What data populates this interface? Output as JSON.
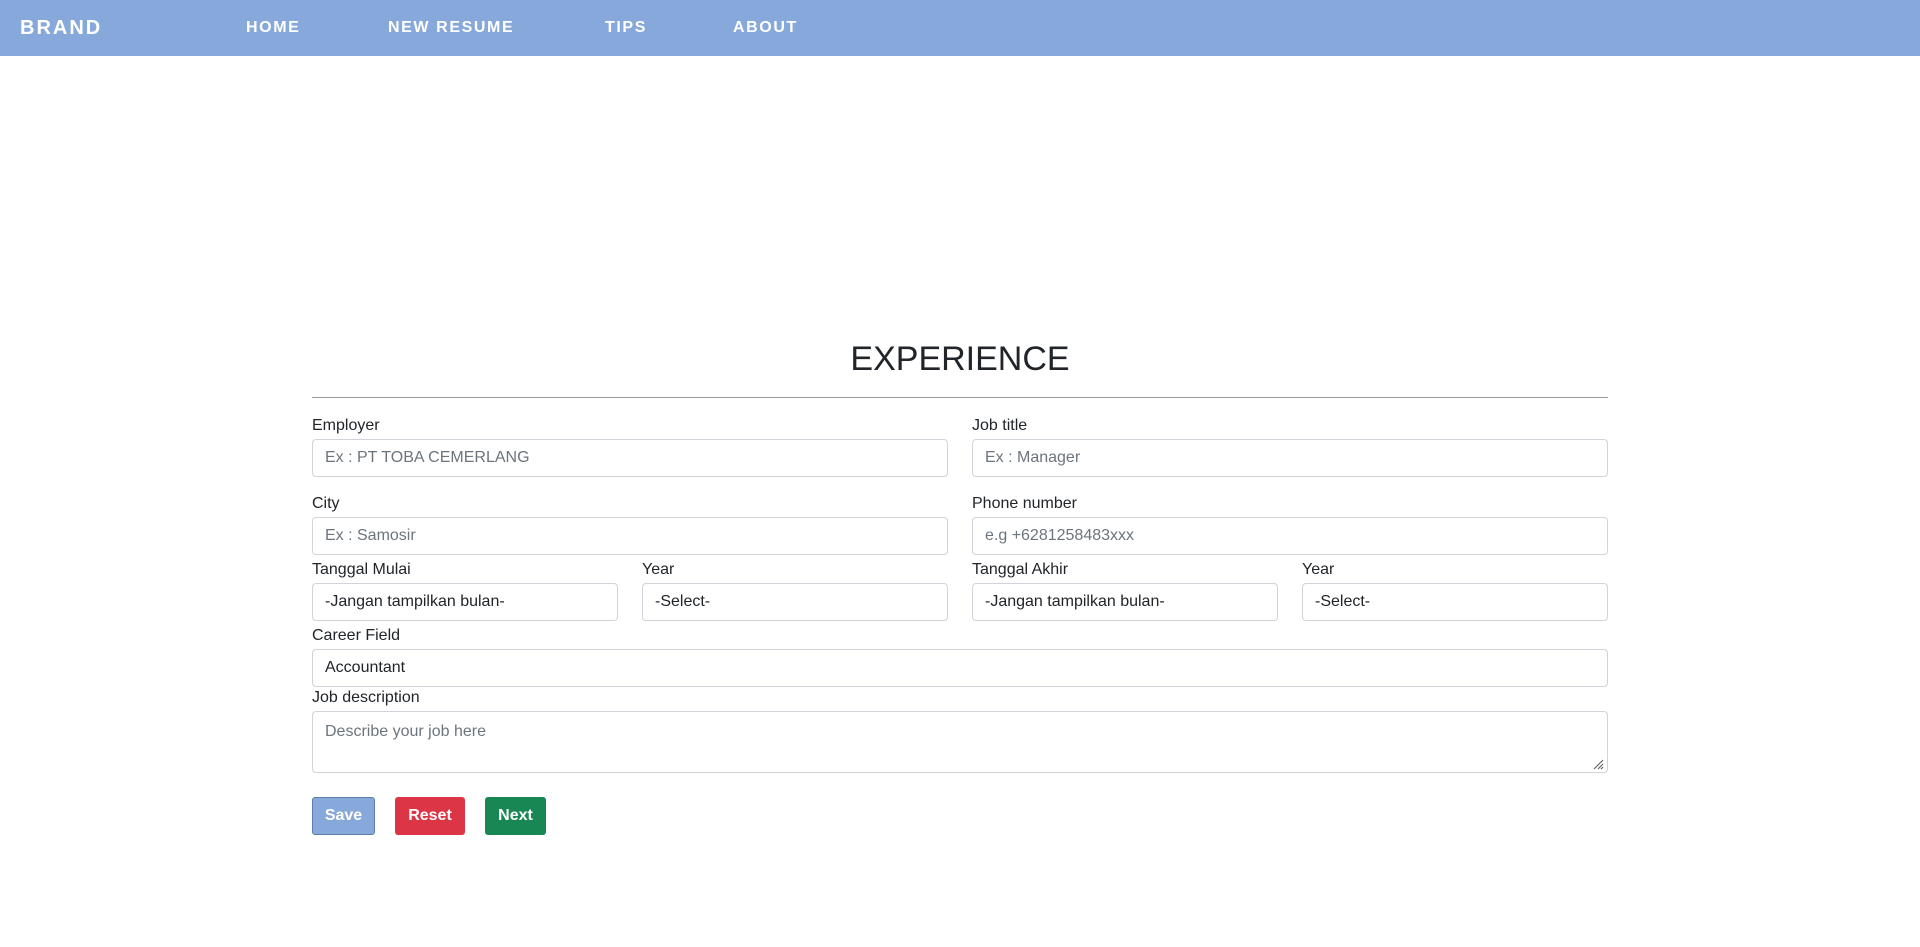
{
  "nav": {
    "brand": "BRAND",
    "links": [
      "HOME",
      "NEW RESUME",
      "TIPS",
      "ABOUT"
    ]
  },
  "form": {
    "title": "EXPERIENCE",
    "employer": {
      "label": "Employer",
      "placeholder": "Ex : PT TOBA CEMERLANG"
    },
    "job_title": {
      "label": "Job title",
      "placeholder": "Ex : Manager"
    },
    "city": {
      "label": "City",
      "placeholder": "Ex : Samosir"
    },
    "phone": {
      "label": "Phone number",
      "placeholder": "e.g +6281258483xxx"
    },
    "start_month": {
      "label": "Tanggal Mulai",
      "value": "-Jangan tampilkan bulan-"
    },
    "start_year": {
      "label": "Year",
      "value": "-Select-"
    },
    "end_month": {
      "label": "Tanggal Akhir",
      "value": "-Jangan tampilkan bulan-"
    },
    "end_year": {
      "label": "Year",
      "value": "-Select-"
    },
    "career_field": {
      "label": "Career Field",
      "value": "Accountant"
    },
    "job_description": {
      "label": "Job description",
      "placeholder": "Describe your job here"
    }
  },
  "buttons": {
    "save": "Save",
    "reset": "Reset",
    "next": "Next"
  },
  "colors": {
    "navbar": "#87a8da",
    "save": "#87a8da",
    "reset": "#dc3545",
    "next": "#198754"
  }
}
